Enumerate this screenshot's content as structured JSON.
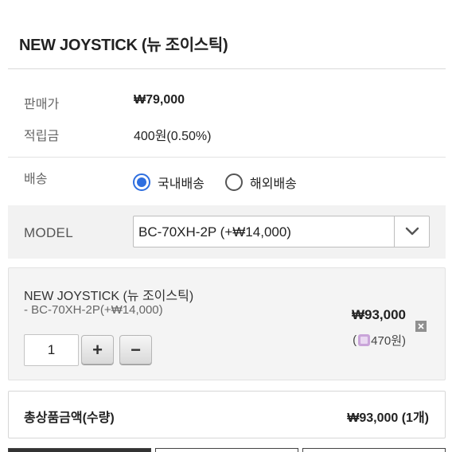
{
  "product": {
    "title": "NEW JOYSTICK (뉴 조이스틱)"
  },
  "info": {
    "price_label": "판매가",
    "price_value": "₩79,000",
    "points_label": "적립금",
    "points_value": "400원(0.50%)"
  },
  "shipping": {
    "label": "배송",
    "options": [
      {
        "label": "국내배송",
        "selected": true
      },
      {
        "label": "해외배송",
        "selected": false
      }
    ]
  },
  "model": {
    "label": "MODEL",
    "selected_value": "BC-70XH-2P (+₩14,000)"
  },
  "selected_option": {
    "name": "NEW JOYSTICK (뉴 조이스틱)",
    "variant": "- BC-70XH-2P(+₩14,000)",
    "quantity": "1",
    "plus_label": "+",
    "minus_label": "−",
    "price": "₩93,000",
    "points_prefix": "(",
    "points_value": "470원)"
  },
  "total": {
    "label": "총상품금액(수량)",
    "value": "₩93,000 (1개)"
  },
  "colors": {
    "radio_accent": "#2f6fdf",
    "model_bg": "#f2f2f2",
    "option_bg": "#f4f4f4"
  }
}
